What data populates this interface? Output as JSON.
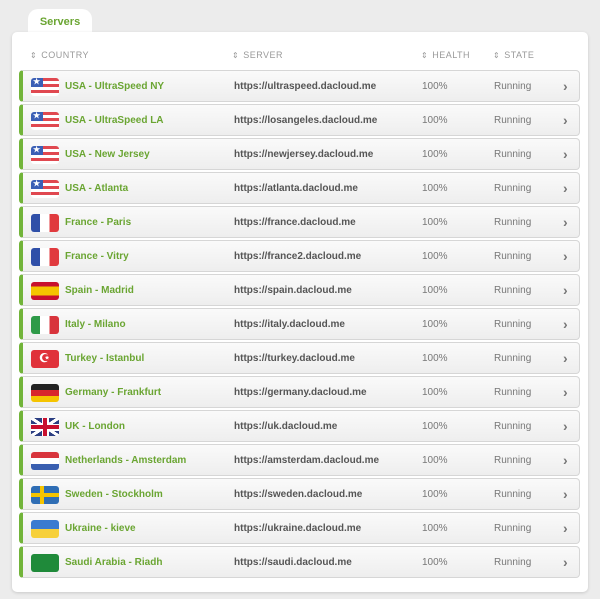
{
  "tab": {
    "label": "Servers"
  },
  "headers": {
    "country": "COUNTRY",
    "server": "SERVER",
    "health": "HEALTH",
    "state": "STATE",
    "sort_icon": "⇕"
  },
  "rows": [
    {
      "country": "USA - UltraSpeed NY",
      "server": "https://ultraspeed.dacloud.me",
      "health": "100%",
      "state": "Running",
      "flag": "us"
    },
    {
      "country": "USA - UltraSpeed LA",
      "server": "https://losangeles.dacloud.me",
      "health": "100%",
      "state": "Running",
      "flag": "us"
    },
    {
      "country": "USA - New Jersey",
      "server": "https://newjersey.dacloud.me",
      "health": "100%",
      "state": "Running",
      "flag": "us"
    },
    {
      "country": "USA - Atlanta",
      "server": "https://atlanta.dacloud.me",
      "health": "100%",
      "state": "Running",
      "flag": "us"
    },
    {
      "country": "France - Paris",
      "server": "https://france.dacloud.me",
      "health": "100%",
      "state": "Running",
      "flag": "fr"
    },
    {
      "country": "France - Vitry",
      "server": "https://france2.dacloud.me",
      "health": "100%",
      "state": "Running",
      "flag": "fr"
    },
    {
      "country": "Spain - Madrid",
      "server": "https://spain.dacloud.me",
      "health": "100%",
      "state": "Running",
      "flag": "es"
    },
    {
      "country": "Italy - Milano",
      "server": "https://italy.dacloud.me",
      "health": "100%",
      "state": "Running",
      "flag": "it"
    },
    {
      "country": "Turkey - Istanbul",
      "server": "https://turkey.dacloud.me",
      "health": "100%",
      "state": "Running",
      "flag": "tr"
    },
    {
      "country": "Germany - Frankfurt",
      "server": "https://germany.dacloud.me",
      "health": "100%",
      "state": "Running",
      "flag": "de"
    },
    {
      "country": "UK - London",
      "server": "https://uk.dacloud.me",
      "health": "100%",
      "state": "Running",
      "flag": "uk"
    },
    {
      "country": "Netherlands - Amsterdam",
      "server": "https://amsterdam.dacloud.me",
      "health": "100%",
      "state": "Running",
      "flag": "nl"
    },
    {
      "country": "Sweden - Stockholm",
      "server": "https://sweden.dacloud.me",
      "health": "100%",
      "state": "Running",
      "flag": "se"
    },
    {
      "country": "Ukraine - kieve",
      "server": "https://ukraine.dacloud.me",
      "health": "100%",
      "state": "Running",
      "flag": "ua"
    },
    {
      "country": "Saudi Arabia - Riadh",
      "server": "https://saudi.dacloud.me",
      "health": "100%",
      "state": "Running",
      "flag": "sa"
    }
  ]
}
